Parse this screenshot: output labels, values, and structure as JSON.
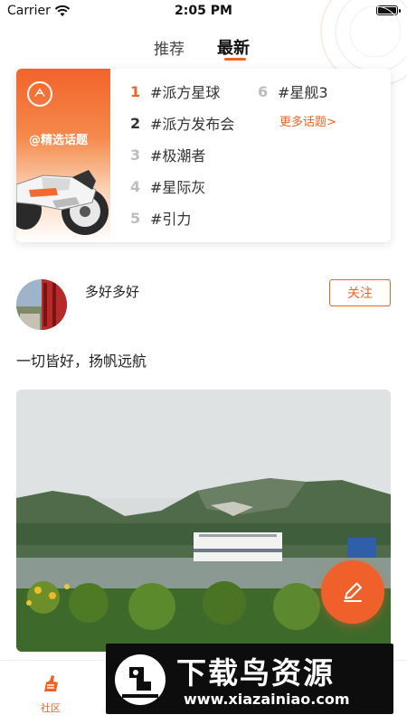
{
  "status_bar": {
    "carrier": "Carrier",
    "time": "2:05 PM"
  },
  "tabs": [
    {
      "label": "推荐",
      "active": false
    },
    {
      "label": "最新",
      "active": true
    }
  ],
  "topic_card": {
    "banner_text": "@精选话题",
    "topics": [
      {
        "rank": "1",
        "name": "#派方星球"
      },
      {
        "rank": "2",
        "name": "#派方发布会"
      },
      {
        "rank": "3",
        "name": "#极潮者"
      },
      {
        "rank": "4",
        "name": "#星际灰"
      },
      {
        "rank": "5",
        "name": "#引力"
      },
      {
        "rank": "6",
        "name": "#星舰3"
      }
    ],
    "more_label": "更多话题>"
  },
  "post": {
    "username": "多好多好",
    "follow_label": "关注",
    "text": "一切皆好，扬帆远航"
  },
  "bottom_nav": {
    "community_label": "社区"
  },
  "watermark": {
    "title": "下载鸟资源",
    "url": "www.xiazainiao.com"
  },
  "colors": {
    "accent": "#f06322",
    "text": "#222222"
  }
}
